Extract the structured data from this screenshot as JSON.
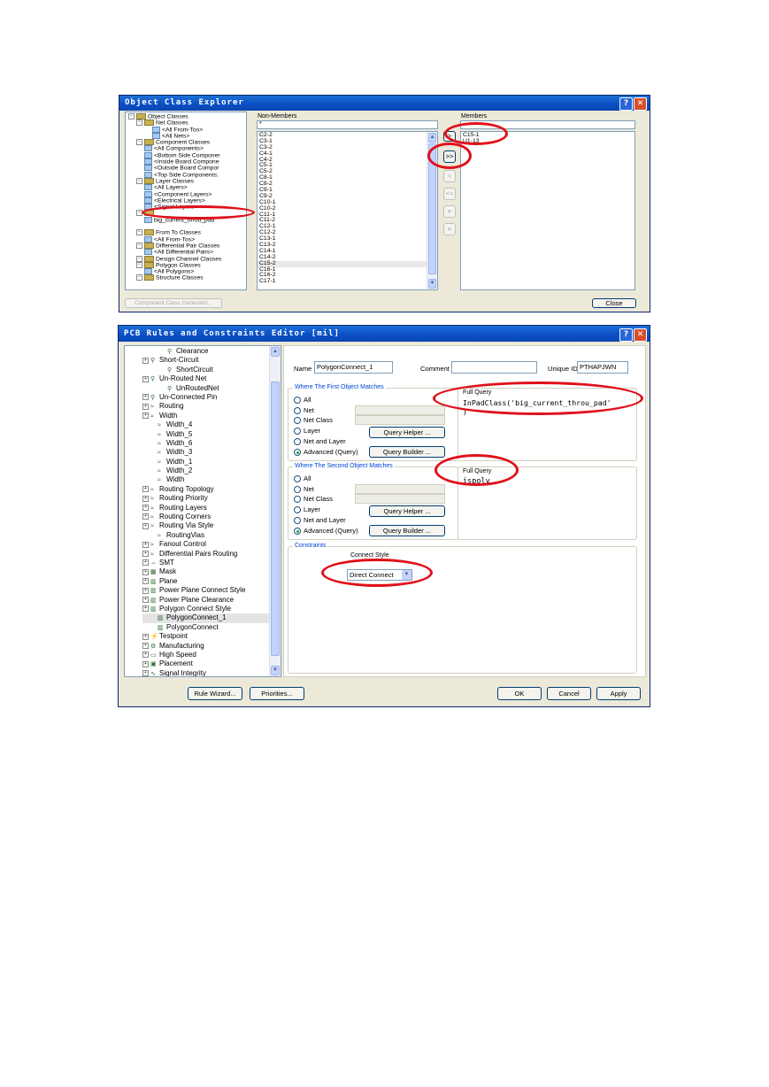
{
  "object_class_explorer": {
    "title": "Object Class Explorer",
    "help_label": "?",
    "close_label": "✕",
    "tree": [
      {
        "label": "Object Classes",
        "indent": 0,
        "icon": "folder"
      },
      {
        "label": "Net Classes",
        "indent": 1,
        "icon": "folder"
      },
      {
        "label": "<All From-Tos>",
        "indent": 3,
        "icon": "class"
      },
      {
        "label": "<All Nets>",
        "indent": 3,
        "icon": "class"
      },
      {
        "label": "Component Classes",
        "indent": 1,
        "icon": "folder"
      },
      {
        "label": "<All Components>",
        "indent": 2,
        "icon": "class"
      },
      {
        "label": "<Bottom Side Componer",
        "indent": 2,
        "icon": "class"
      },
      {
        "label": "<Inside Board Compone",
        "indent": 2,
        "icon": "class"
      },
      {
        "label": "<Outside Board Compor",
        "indent": 2,
        "icon": "class"
      },
      {
        "label": "<Top Side Components:",
        "indent": 2,
        "icon": "class"
      },
      {
        "label": "Layer Classes",
        "indent": 1,
        "icon": "folder"
      },
      {
        "label": "<All Layers>",
        "indent": 2,
        "icon": "class"
      },
      {
        "label": "<Component Layers>",
        "indent": 2,
        "icon": "class"
      },
      {
        "label": "<Electrical Layers>",
        "indent": 2,
        "icon": "class"
      },
      {
        "label": "<Signal Layers>",
        "indent": 2,
        "icon": "class"
      },
      {
        "label": "",
        "indent": 1,
        "icon": "folder"
      },
      {
        "label": "big_current_throu_pad",
        "indent": 2,
        "icon": "class"
      },
      {
        "label": "",
        "indent": 0,
        "icon": "none"
      },
      {
        "label": "From To Classes",
        "indent": 1,
        "icon": "folder"
      },
      {
        "label": "<All From-Tos>",
        "indent": 2,
        "icon": "class"
      },
      {
        "label": "Differential Pair Classes",
        "indent": 1,
        "icon": "folder"
      },
      {
        "label": "<All Differential Pairs>",
        "indent": 2,
        "icon": "class"
      },
      {
        "label": "Design Channel Classes",
        "indent": 1,
        "icon": "folder"
      },
      {
        "label": "Polygon Classes",
        "indent": 1,
        "icon": "folder"
      },
      {
        "label": "<All Polygons>",
        "indent": 2,
        "icon": "class"
      },
      {
        "label": "Structure Classes",
        "indent": 1,
        "icon": "folder"
      }
    ],
    "non_members_label": "Non-Members",
    "non_members_filter": "*",
    "non_members": [
      "C2-2",
      "C3-1",
      "C3-2",
      "C4-1",
      "C4-2",
      "C5-1",
      "C5-2",
      "C8-1",
      "C8-2",
      "C9-1",
      "C9-2",
      "C10-1",
      "C10-2",
      "C11-1",
      "C11-2",
      "C12-1",
      "C12-2",
      "C13-1",
      "C13-2",
      "C14-1",
      "C14-2",
      "C15-2",
      "C16-1",
      "C16-2",
      "C17-1"
    ],
    "members_label": "Members",
    "members": [
      "C15-1",
      "U1-13"
    ],
    "move_buttons": [
      ">",
      ">>",
      "<",
      "<<",
      "≡",
      "≡"
    ],
    "generator_button": "Component Class Generator...",
    "close_button": "Close"
  },
  "rules_editor": {
    "title": "PCB Rules and Constraints Editor [mil]",
    "help_label": "?",
    "close_label": "✕",
    "tree": [
      {
        "label": "Clearance",
        "indent": 3,
        "icon": "rule"
      },
      {
        "label": "Short-Circuit",
        "indent": 1,
        "icon": "rule"
      },
      {
        "label": "ShortCircuit",
        "indent": 3,
        "icon": "rule"
      },
      {
        "label": "Un-Routed Net",
        "indent": 1,
        "icon": "rule"
      },
      {
        "label": "UnRoutedNet",
        "indent": 3,
        "icon": "rule"
      },
      {
        "label": "Un-Connected Pin",
        "indent": 1,
        "icon": "rule"
      },
      {
        "label": "Routing",
        "indent": 0,
        "icon": "route"
      },
      {
        "label": "Width",
        "indent": 1,
        "icon": "route"
      },
      {
        "label": "Width_4",
        "indent": 2,
        "icon": "route"
      },
      {
        "label": "Width_5",
        "indent": 2,
        "icon": "route"
      },
      {
        "label": "Width_6",
        "indent": 2,
        "icon": "route"
      },
      {
        "label": "Width_3",
        "indent": 2,
        "icon": "route"
      },
      {
        "label": "Width_1",
        "indent": 2,
        "icon": "route"
      },
      {
        "label": "Width_2",
        "indent": 2,
        "icon": "route"
      },
      {
        "label": "Width",
        "indent": 2,
        "icon": "route"
      },
      {
        "label": "Routing Topology",
        "indent": 1,
        "icon": "route"
      },
      {
        "label": "Routing Priority",
        "indent": 1,
        "icon": "route"
      },
      {
        "label": "Routing Layers",
        "indent": 1,
        "icon": "route"
      },
      {
        "label": "Routing Corners",
        "indent": 1,
        "icon": "route"
      },
      {
        "label": "Routing Via Style",
        "indent": 1,
        "icon": "route"
      },
      {
        "label": "RoutingVias",
        "indent": 2,
        "icon": "route"
      },
      {
        "label": "Fanout Control",
        "indent": 1,
        "icon": "route"
      },
      {
        "label": "Differential Pairs Routing",
        "indent": 1,
        "icon": "route"
      },
      {
        "label": "SMT",
        "indent": 0,
        "icon": "smt"
      },
      {
        "label": "Mask",
        "indent": 0,
        "icon": "mask"
      },
      {
        "label": "Plane",
        "indent": 0,
        "icon": "plane"
      },
      {
        "label": "Power Plane Connect Style",
        "indent": 1,
        "icon": "plane"
      },
      {
        "label": "Power Plane Clearance",
        "indent": 1,
        "icon": "plane"
      },
      {
        "label": "Polygon Connect Style",
        "indent": 1,
        "icon": "plane"
      },
      {
        "label": "PolygonConnect_1",
        "indent": 2,
        "icon": "plane",
        "selected": true
      },
      {
        "label": "PolygonConnect",
        "indent": 2,
        "icon": "plane"
      },
      {
        "label": "Testpoint",
        "indent": 0,
        "icon": "test"
      },
      {
        "label": "Manufacturing",
        "indent": 0,
        "icon": "mfg"
      },
      {
        "label": "High Speed",
        "indent": 0,
        "icon": "hs"
      },
      {
        "label": "Placement",
        "indent": 0,
        "icon": "place"
      },
      {
        "label": "Signal Integrity",
        "indent": 0,
        "icon": "si"
      }
    ],
    "name_label": "Name",
    "name_value": "PolygonConnect_1",
    "comment_label": "Comment",
    "comment_value": "",
    "uid_label": "Unique ID",
    "uid_value": "PTHAPJWN",
    "first_group": "Where The First Object Matches",
    "second_group": "Where The Second Object Matches",
    "radio_options": [
      "All",
      "Net",
      "Net Class",
      "Layer",
      "Net and Layer",
      "Advanced (Query)"
    ],
    "query_helper": "Query Helper ...",
    "query_builder": "Query Builder ...",
    "full_query_label_1": "Full Query",
    "full_query_1": "InPadClass('big_current_throu_pad'",
    "full_query_1_line2": ")",
    "full_query_label_2": "Full Query",
    "full_query_2": "ispoly",
    "constraints_label": "Constraints",
    "connect_style_label": "Connect Style",
    "connect_style_value": "Direct Connect",
    "rule_wizard": "Rule Wizard...",
    "priorities": "Priorities...",
    "ok": "OK",
    "cancel": "Cancel",
    "apply": "Apply"
  }
}
